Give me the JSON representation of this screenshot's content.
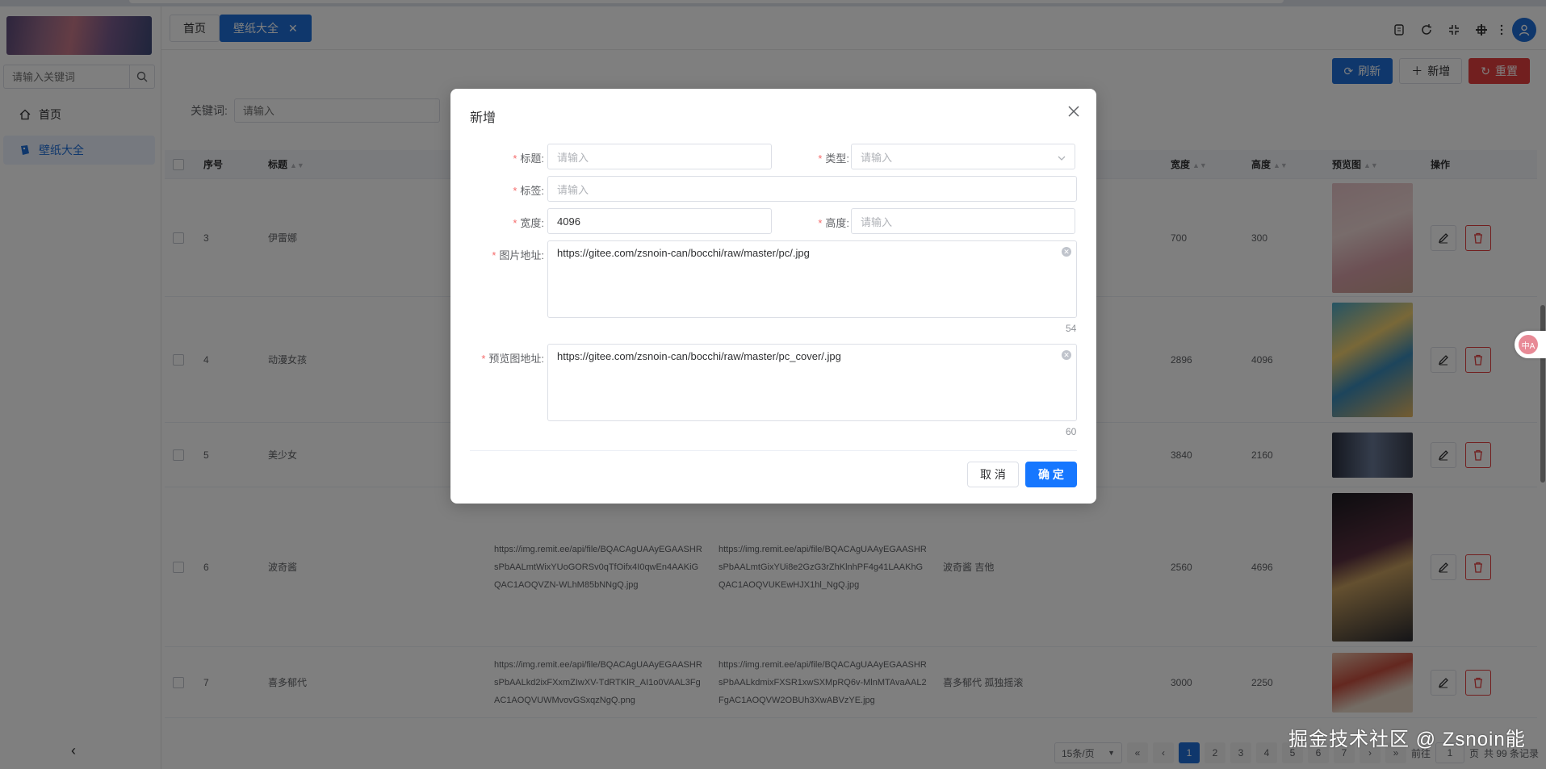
{
  "colors": {
    "primary": "#1e6fd9",
    "danger": "#e53e3e",
    "confirm": "#1677ff"
  },
  "sidebar": {
    "search_placeholder": "请输入关键词",
    "items": [
      {
        "label": "首页",
        "icon": "home-icon"
      },
      {
        "label": "壁纸大全",
        "icon": "picture-icon"
      }
    ]
  },
  "header": {
    "tabs": [
      {
        "label": "首页"
      },
      {
        "label": "壁纸大全",
        "closable": true
      }
    ],
    "icons": [
      "clipboard-icon",
      "refresh-icon",
      "fullscreen-icon",
      "settings-icon",
      "user-avatar-icon"
    ]
  },
  "toolbar": {
    "refresh_label": "刷新",
    "add_label": "新增",
    "reset_label": "重置"
  },
  "filter": {
    "keyword_label": "关键词:",
    "keyword_placeholder": "请输入"
  },
  "table": {
    "headers": {
      "no": "序号",
      "title": "标题",
      "width": "宽度",
      "height": "高度",
      "preview": "预览图",
      "ops": "操作"
    },
    "rows": [
      {
        "no": "3",
        "title": "伊雷娜",
        "url": "",
        "cover": "",
        "tags": "",
        "width": "700",
        "height": "300"
      },
      {
        "no": "4",
        "title": "动漫女孩",
        "url": "",
        "cover": "",
        "tags": "",
        "width": "2896",
        "height": "4096"
      },
      {
        "no": "5",
        "title": "美少女",
        "url": "",
        "cover": "",
        "tags": "",
        "width": "3840",
        "height": "2160"
      },
      {
        "no": "6",
        "title": "波奇酱",
        "url": "https://img.remit.ee/api/file/BQACAgUAAyEGAASHRsPbAALmtWixYUoGORSv0qTfOifx4I0qwEn4AAKiGQAC1AOQVZN-WLhM85bNNgQ.jpg",
        "cover": "https://img.remit.ee/api/file/BQACAgUAAyEGAASHRsPbAALmtGixYUi8e2GzG3rZhKlnhPF4g41LAAKhGQAC1AOQVUKEwHJX1hl_NgQ.jpg",
        "tags": "波奇酱 吉他",
        "width": "2560",
        "height": "4696"
      },
      {
        "no": "7",
        "title": "喜多郁代",
        "url": "https://img.remit.ee/api/file/BQACAgUAAyEGAASHRsPbAALkd2ixFXxmZIwXV-TdRTKlR_AI1o0VAAL3FgAC1AOQVUWMvovGSxqzNgQ.png",
        "cover": "https://img.remit.ee/api/file/BQACAgUAAyEGAASHRsPbAALkdmixFXSR1xwSXMpRQ6v-MlnMTAvaAAL2FgAC1AOQVW2OBUh3XwABVzYE.jpg",
        "tags": "喜多郁代 孤独摇滚",
        "width": "3000",
        "height": "2250"
      }
    ]
  },
  "pagination": {
    "page_size": "15条/页",
    "pages": [
      "1",
      "2",
      "3",
      "4",
      "5",
      "6",
      "7"
    ],
    "goto_label": "前往",
    "goto_value": "1",
    "page_unit": "页",
    "total": "共 99 条记录"
  },
  "modal": {
    "title": "新增",
    "fields": {
      "title_label": "标题:",
      "title_placeholder": "请输入",
      "type_label": "类型:",
      "type_placeholder": "请输入",
      "tags_label": "标签:",
      "tags_placeholder": "请输入",
      "width_label": "宽度:",
      "width_value": "4096",
      "height_label": "高度:",
      "height_placeholder": "请输入",
      "url_label": "图片地址:",
      "url_value": "https://gitee.com/zsnoin-can/bocchi/raw/master/pc/.jpg",
      "url_count": "54",
      "cover_label": "预览图地址:",
      "cover_value": "https://gitee.com/zsnoin-can/bocchi/raw/master/pc_cover/.jpg",
      "cover_count": "60"
    },
    "cancel_label": "取 消",
    "confirm_label": "确 定"
  },
  "watermark": "掘金技术社区 @ Zsnoin能",
  "translate_widget": "中A"
}
